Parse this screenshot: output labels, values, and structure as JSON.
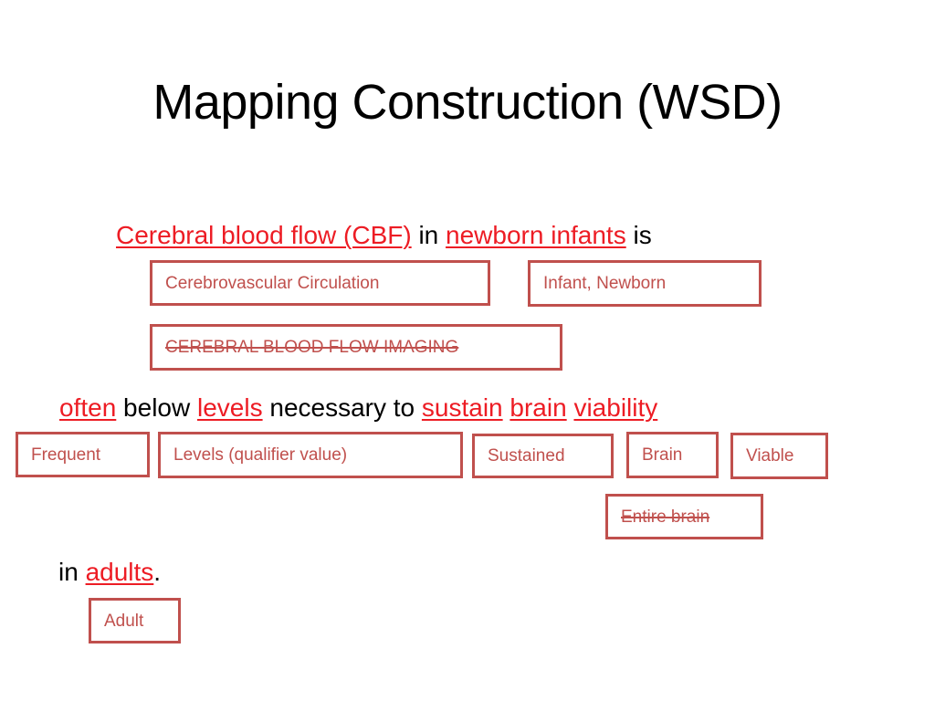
{
  "slide": {
    "title": "Mapping Construction (WSD)",
    "background_color": "#FFFFFF",
    "highlight_color": "#ED1C24",
    "box_color": "#C0504D"
  },
  "lines": [
    {
      "id": "line-cbf",
      "segments": [
        {
          "text": "Cerebral blood flow (CBF)",
          "highlight": true
        },
        {
          "text": " in ",
          "highlight": false
        },
        {
          "text": "newborn infants",
          "highlight": true
        },
        {
          "text": " is",
          "highlight": false
        }
      ]
    },
    {
      "id": "line-often",
      "segments": [
        {
          "text": "often",
          "highlight": true
        },
        {
          "text": " below ",
          "highlight": false
        },
        {
          "text": "levels",
          "highlight": true
        },
        {
          "text": " necessary to ",
          "highlight": false
        },
        {
          "text": "sustain",
          "highlight": true
        },
        {
          "text": " ",
          "highlight": false
        },
        {
          "text": "brain",
          "highlight": true
        },
        {
          "text": " ",
          "highlight": false
        },
        {
          "text": "viability",
          "highlight": true
        }
      ]
    },
    {
      "id": "line-adults",
      "segments": [
        {
          "text": "in ",
          "highlight": false
        },
        {
          "text": "adults",
          "highlight": true
        },
        {
          "text": ".",
          "highlight": false
        }
      ]
    }
  ],
  "boxes": {
    "cerebrovascular": {
      "label": "Cerebrovascular Circulation",
      "struck": false
    },
    "infant": {
      "label": "Infant, Newborn",
      "struck": false
    },
    "cbf_imaging": {
      "label": "CEREBRAL BLOOD FLOW IMAGING",
      "struck": true
    },
    "frequent": {
      "label": "Frequent",
      "struck": false
    },
    "levels": {
      "label": "Levels (qualifier value)",
      "struck": false
    },
    "sustained": {
      "label": "Sustained",
      "struck": false
    },
    "brain": {
      "label": "Brain",
      "struck": false
    },
    "viable": {
      "label": "Viable",
      "struck": false
    },
    "entire_brain": {
      "label": "Entire brain",
      "struck": true
    },
    "adult": {
      "label": "Adult",
      "struck": false
    }
  }
}
